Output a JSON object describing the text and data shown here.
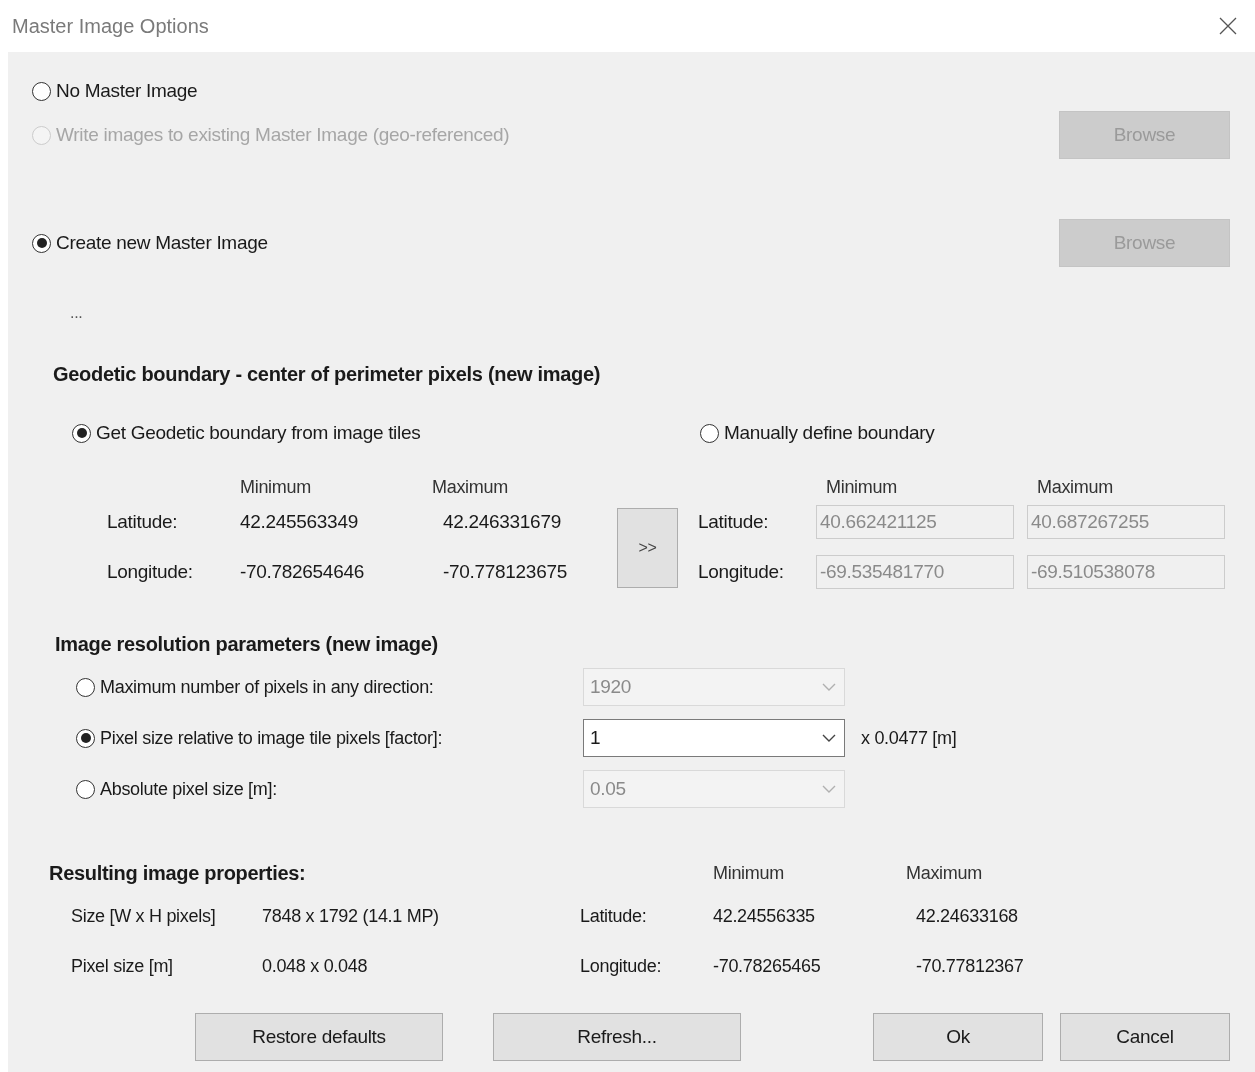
{
  "window": {
    "title": "Master Image Options"
  },
  "master_options": [
    {
      "label": "No Master Image",
      "selected": false,
      "disabled": false
    },
    {
      "label": "Write images to existing Master Image (geo-referenced)",
      "selected": false,
      "disabled": true,
      "browse": {
        "label": "Browse",
        "disabled": true
      }
    },
    {
      "label": "Create new Master Image",
      "selected": true,
      "disabled": false,
      "browse": {
        "label": "Browse",
        "disabled": true
      }
    }
  ],
  "ellipsis": "...",
  "geodetic": {
    "heading": "Geodetic boundary - center of perimeter pixels (new image)",
    "source_options": [
      {
        "label": "Get Geodetic boundary from image tiles",
        "selected": true
      },
      {
        "label": "Manually define boundary",
        "selected": false
      }
    ],
    "from_tiles": {
      "columns": [
        "Minimum",
        "Maximum"
      ],
      "rows": [
        {
          "label": "Latitude:",
          "min": "42.245563349",
          "max": "42.246331679"
        },
        {
          "label": "Longitude:",
          "min": "-70.782654646",
          "max": "-70.778123675"
        }
      ]
    },
    "copy_button": ">>",
    "manual": {
      "disabled": true,
      "columns": [
        "Minimum",
        "Maximum"
      ],
      "rows": [
        {
          "label": "Latitude:",
          "min": "40.662421125",
          "max": "40.687267255"
        },
        {
          "label": "Longitude:",
          "min": "-69.535481770",
          "max": "-69.510538078"
        }
      ]
    }
  },
  "resolution": {
    "heading": "Image resolution parameters (new image)",
    "options": [
      {
        "label": "Maximum number of pixels in any direction:",
        "selected": false,
        "value": "1920",
        "disabled": true
      },
      {
        "label": "Pixel size relative to image tile pixels [factor]:",
        "selected": true,
        "value": "1",
        "disabled": false,
        "suffix": "x 0.0477 [m]"
      },
      {
        "label": "Absolute pixel size [m]:",
        "selected": false,
        "value": "0.05",
        "disabled": true
      }
    ]
  },
  "result": {
    "heading": "Resulting image properties:",
    "columns": [
      "Minimum",
      "Maximum"
    ],
    "rows": [
      {
        "label": "Size [W x H pixels]",
        "value": "7848 x 1792 (14.1 MP)",
        "geo_label": "Latitude:",
        "min": "42.24556335",
        "max": "42.24633168"
      },
      {
        "label": "Pixel size [m]",
        "value": "0.048 x 0.048",
        "geo_label": "Longitude:",
        "min": "-70.78265465",
        "max": "-70.77812367"
      }
    ]
  },
  "buttons": [
    {
      "label": "Restore defaults"
    },
    {
      "label": "Refresh..."
    },
    {
      "label": "Ok"
    },
    {
      "label": "Cancel"
    }
  ]
}
